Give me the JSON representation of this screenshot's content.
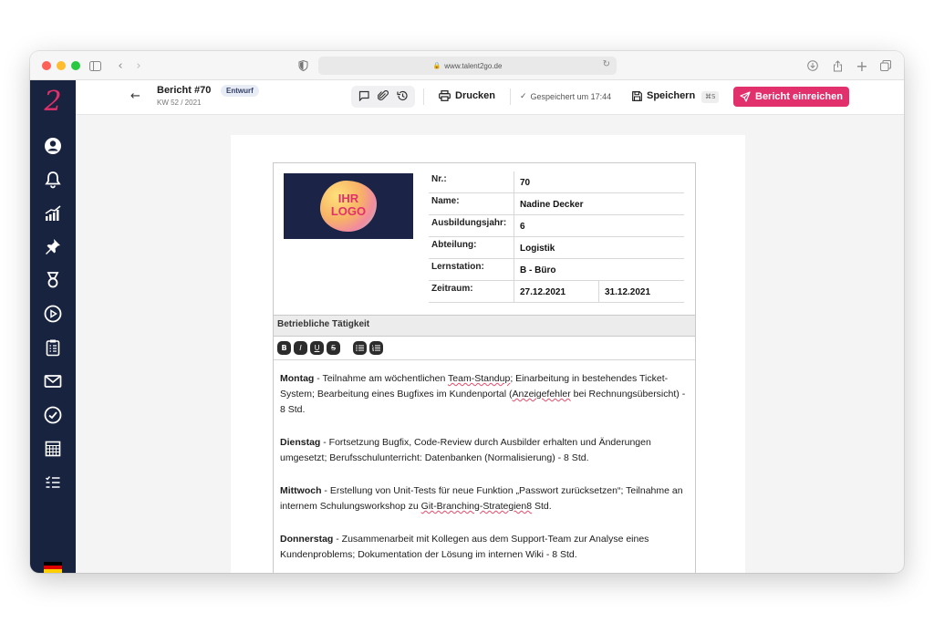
{
  "browser": {
    "url": "www.talent2go.de"
  },
  "app": {
    "logo_glyph": "2",
    "brand_color": "#e2306c",
    "sidebar_bg": "#18233f",
    "sidebar_icons": [
      "user-icon",
      "bell-icon",
      "chart-icon",
      "pin-icon",
      "medal-icon",
      "play-icon",
      "clipboard-icon",
      "mail-icon",
      "check-circle-icon",
      "calendar-icon",
      "checklist-icon"
    ]
  },
  "header": {
    "back_glyph": "←",
    "title": "Bericht #70",
    "badge": "Entwurf",
    "subtitle": "KW 52 / 2021",
    "print_label": "Drucken",
    "saved_status": "Gespeichert um 17:44",
    "save_label": "Speichern",
    "save_shortcut": "⌘S",
    "submit_label": "Bericht einreichen"
  },
  "report": {
    "logo_line1": "IHR",
    "logo_line2": "LOGO",
    "fields": [
      {
        "label": "Nr.:",
        "value": "70"
      },
      {
        "label": "Name:",
        "value": "Nadine Decker"
      },
      {
        "label": "Ausbildungsjahr:",
        "value": "6"
      },
      {
        "label": "Abteilung:",
        "value": "Logistik"
      },
      {
        "label": "Lernstation:",
        "value": "B - Büro"
      },
      {
        "label": "Zeitraum:",
        "value": "27.12.2021",
        "value2": "31.12.2021"
      }
    ],
    "section_title": "Betriebliche Tätigkeit",
    "toolbar": [
      "B",
      "I",
      "U",
      "S",
      "list-bulleted",
      "list-numbered"
    ],
    "entries": [
      {
        "day": "Montag",
        "t1": " - Teilnahme am wöchentlichen ",
        "sq1": "Team-Standup",
        "t2": "; Einarbeitung in bestehendes Ticket-System; Bearbeitung eines Bugfixes im Kundenportal (",
        "sq2": "Anzeigefehler",
        "t3": " bei Rechnungsübersicht) - 8 Std."
      },
      {
        "day": "Dienstag",
        "t1": " - Fortsetzung Bugfix, Code-Review durch Ausbilder erhalten und Änderungen umgesetzt; Berufsschulunterricht: Datenbanken (Normalisierung) - 8 Std."
      },
      {
        "day": "Mittwoch",
        "t1": " - Erstellung von Unit-Tests für neue Funktion „Passwort zurücksetzen“; Teilnahme an internem Schulungsworkshop zu ",
        "sq1": "Git-Branching-Strategien8",
        "t2": " Std."
      },
      {
        "day": "Donnerstag",
        "t1": " - Zusammenarbeit mit Kollegen aus dem Support-Team zur Analyse eines Kundenproblems; Dokumentation der Lösung im internen Wiki - 8 Std."
      }
    ]
  }
}
